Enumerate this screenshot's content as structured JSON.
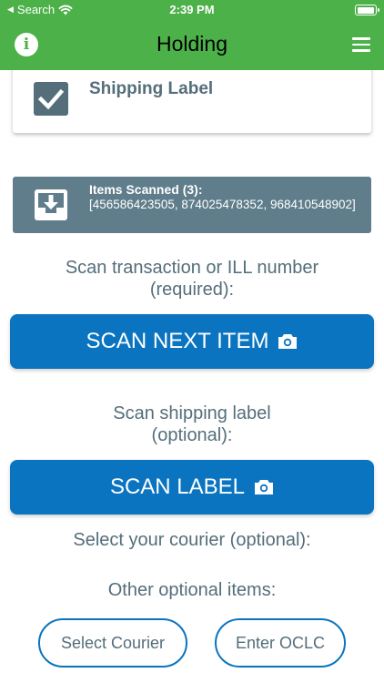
{
  "status_bar": {
    "back_label": "Search",
    "time": "2:39 PM",
    "battery_level": 1.0
  },
  "nav": {
    "title": "Holding"
  },
  "shipping_label_card": {
    "label": "Shipping Label",
    "checked": true
  },
  "items_scanned": {
    "title": "Items Scanned (3):",
    "list_text": "[456586423505, 874025478352, 968410548902]"
  },
  "prompts": {
    "scan_transaction": "Scan transaction or ILL number (required):",
    "scan_shipping": "Scan shipping label (optional):",
    "select_courier": "Select your courier (optional):",
    "other_items": "Other optional items:"
  },
  "buttons": {
    "scan_next_item": "SCAN NEXT ITEM",
    "scan_label": "SCAN LABEL",
    "select_courier": "Select Courier",
    "enter_oclc": "Enter OCLC"
  },
  "colors": {
    "header_green": "#4db14a",
    "primary_blue": "#0a74c0",
    "slate": "#546e7a",
    "banner_gray": "#607d8b"
  }
}
